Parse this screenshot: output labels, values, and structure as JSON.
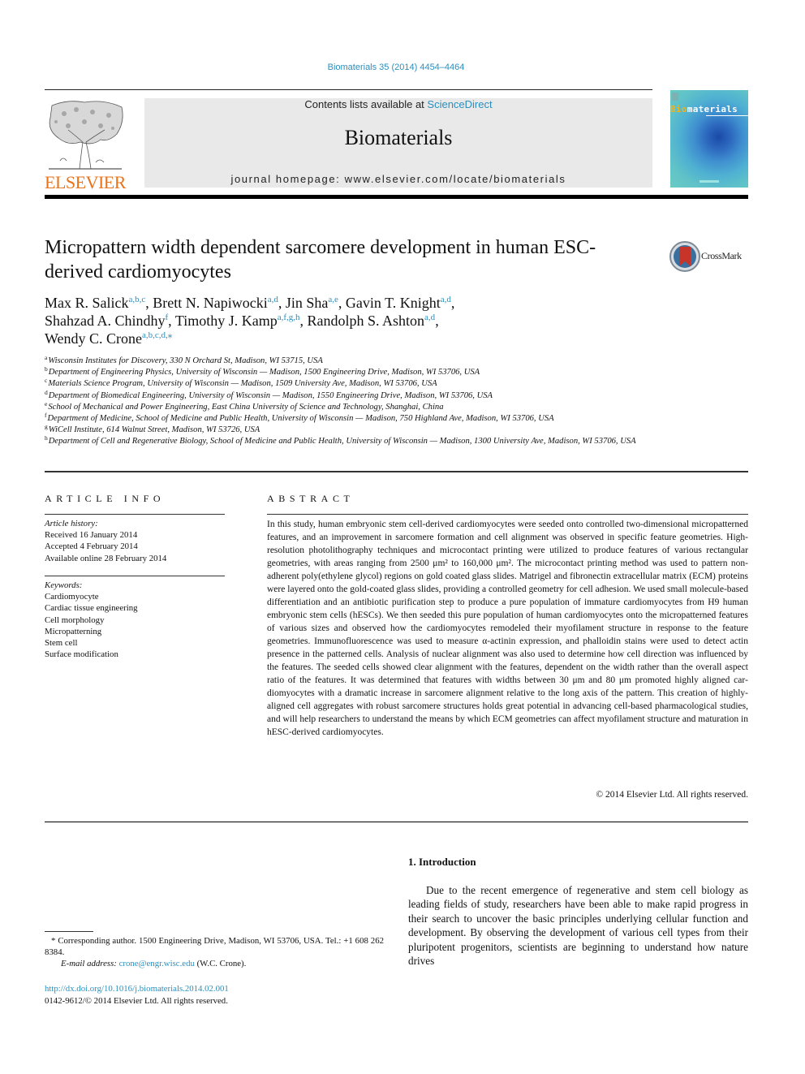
{
  "header": {
    "citation": "Biomaterials 35 (2014) 4454–4464",
    "contents_prefix": "Contents lists available at ",
    "contents_link": "ScienceDirect",
    "journal_name": "Biomaterials",
    "homepage": "journal homepage: www.elsevier.com/locate/biomaterials",
    "publisher_logo_text": "ELSEVIER",
    "cover_title_a": "Bio",
    "cover_title_b": "materials",
    "crossmark_label": "CrossMark"
  },
  "colors": {
    "link": "#2a8fbd",
    "elsevier_orange": "#e8731b",
    "journal_box_bg": "#e9e9e9"
  },
  "article": {
    "title": "Micropattern width dependent sarcomere development in human ESC-derived cardiomyocytes",
    "authors": [
      {
        "name": "Max R. Salick",
        "sup": "a,b,c",
        "sep": ", "
      },
      {
        "name": "Brett N. Napiwocki",
        "sup": "a,d",
        "sep": ", "
      },
      {
        "name": "Jin Sha",
        "sup": "a,e",
        "sep": ", "
      },
      {
        "name": "Gavin T. Knight",
        "sup": "a,d",
        "sep": ","
      },
      {
        "name": "Shahzad A. Chindhy",
        "sup": "f",
        "sep": ", "
      },
      {
        "name": "Timothy J. Kamp",
        "sup": "a,f,g,h",
        "sep": ", "
      },
      {
        "name": "Randolph S. Ashton",
        "sup": "a,d",
        "sep": ","
      },
      {
        "name": "Wendy C. Crone",
        "sup": "a,b,c,d,⁎",
        "sep": ""
      }
    ],
    "affiliations": [
      {
        "key": "a",
        "text": "Wisconsin Institutes for Discovery, 330 N Orchard St, Madison, WI 53715, USA"
      },
      {
        "key": "b",
        "text": "Department of Engineering Physics, University of Wisconsin — Madison, 1500 Engineering Drive, Madison, WI 53706, USA"
      },
      {
        "key": "c",
        "text": "Materials Science Program, University of Wisconsin — Madison, 1509 University Ave, Madison, WI 53706, USA"
      },
      {
        "key": "d",
        "text": "Department of Biomedical Engineering, University of Wisconsin — Madison, 1550 Engineering Drive, Madison, WI 53706, USA"
      },
      {
        "key": "e",
        "text": "School of Mechanical and Power Engineering, East China University of Science and Technology, Shanghai, China"
      },
      {
        "key": "f",
        "text": "Department of Medicine, School of Medicine and Public Health, University of Wisconsin — Madison, 750 Highland Ave, Madison, WI 53706, USA"
      },
      {
        "key": "g",
        "text": "WiCell Institute, 614 Walnut Street, Madison, WI 53726, USA"
      },
      {
        "key": "h",
        "text": "Department of Cell and Regenerative Biology, School of Medicine and Public Health, University of Wisconsin — Madison, 1300 University Ave, Madison, WI 53706, USA"
      }
    ]
  },
  "article_info": {
    "heading": "ARTICLE INFO",
    "history_label": "Article history:",
    "history": [
      "Received 16 January 2014",
      "Accepted 4 February 2014",
      "Available online 28 February 2014"
    ],
    "keywords_label": "Keywords:",
    "keywords": [
      "Cardiomyocyte",
      "Cardiac tissue engineering",
      "Cell morphology",
      "Micropatterning",
      "Stem cell",
      "Surface modification"
    ]
  },
  "abstract": {
    "heading": "ABSTRACT",
    "text": "In this study, human embryonic stem cell-derived cardiomyocytes were seeded onto controlled two-dimensional micropatterned features, and an improvement in sarcomere formation and cell alignment was observed in specific feature geometries. High-resolution photolithography techniques and micro­contact printing were utilized to produce features of various rectangular geometries, with areas ranging from 2500 μm² to 160,000 μm². The microcontact printing method was used to pattern non-adherent poly(ethylene glycol) regions on gold coated glass slides. Matrigel and fibronectin extracellular matrix (ECM) proteins were layered onto the gold-coated glass slides, providing a controlled geometry for cell adhesion. We used small molecule-based differentiation and an antibiotic purification step to produce a pure population of immature cardiomyocytes from H9 human embryonic stem cells (hESCs). We then seeded this pure population of human cardiomyocytes onto the micropatterned features of various sizes and observed how the cardiomyocytes remodeled their myofilament structure in response to the feature geometries. Immunofluorescence was used to measure α-actinin expression, and phalloidin stains were used to detect actin presence in the patterned cells. Analysis of nuclear alignment was also used to determine how cell direction was influenced by the features. The seeded cells showed clear alignment with the features, dependent on the width rather than the overall aspect ratio of the features. It was determined that features with widths between 30 μm and 80 μm promoted highly aligned car­diomyocytes with a dramatic increase in sarcomere alignment relative to the long axis of the pattern. This creation of highly-aligned cell aggregates with robust sarcomere structures holds great potential in advancing cell-based pharmacological studies, and will help researchers to understand the means by which ECM geometries can affect myofilament structure and maturation in hESC-derived cardiomyocytes.",
    "copyright": "© 2014 Elsevier Ltd. All rights reserved."
  },
  "introduction": {
    "heading": "1.  Introduction",
    "text": "Due to the recent emergence of regenerative and stem cell biology as leading fields of study, researchers have been able to make rapid progress in their search to uncover the basic principles underlying cellular function and development. By observing the development of various cell types from their pluripotent pro­genitors, scientists are beginning to understand how nature drives"
  },
  "footnotes": {
    "corresponding": "* Corresponding author. 1500 Engineering Drive, Madison, WI 53706, USA. Tel.: +1 608 262 8384.",
    "email_label": "E-mail address: ",
    "email": "crone@engr.wisc.edu",
    "email_suffix": " (W.C. Crone).",
    "doi": "http://dx.doi.org/10.1016/j.biomaterials.2014.02.001",
    "issn": "0142-9612/© 2014 Elsevier Ltd. All rights reserved."
  }
}
